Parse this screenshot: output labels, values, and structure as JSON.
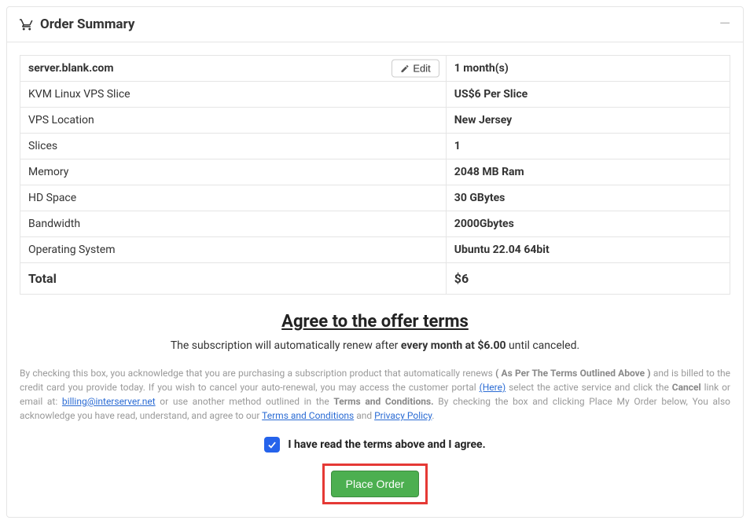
{
  "header": {
    "title": "Order Summary"
  },
  "order": {
    "hostname": "server.blank.com",
    "edit_label": "Edit",
    "rows": [
      {
        "label": "KVM Linux VPS Slice",
        "value": "US$6 Per Slice"
      },
      {
        "label": "VPS Location",
        "value": "New Jersey"
      },
      {
        "label": "Slices",
        "value": "1"
      },
      {
        "label": "Memory",
        "value": "2048 MB Ram"
      },
      {
        "label": "HD Space",
        "value": "30 GBytes"
      },
      {
        "label": "Bandwidth",
        "value": "2000Gbytes"
      },
      {
        "label": "Operating System",
        "value": "Ubuntu 22.04 64bit"
      }
    ],
    "duration": "1 month(s)",
    "total_label": "Total",
    "total_value": "$6"
  },
  "terms": {
    "heading": "Agree to the offer terms",
    "sub_prefix": "The subscription will automatically renew after ",
    "sub_bold": "every month at $6.00",
    "sub_suffix": " until canceled.",
    "fine1": "By checking this box, you acknowledge that you are purchasing a subscription product that automatically renews ",
    "fine1_bold": "( As Per The Terms Outlined Above )",
    "fine1_suffix": " and is billed to the credit card you provide today. If you wish to cancel your auto-renewal, you may access the customer portal ",
    "link_here": "(Here)",
    "fine2": " select the active service and click the ",
    "cancel_bold": "Cancel",
    "fine3": " link or email at: ",
    "email": "billing@interserver.net",
    "fine4": " or use another method outlined in the ",
    "tac_bold": "Terms and Conditions.",
    "fine5": " By checking the box and clicking Place My Order below, You also acknowledge you have read, understand, and agree to our ",
    "link_tac": "Terms and Conditions",
    "and": " and ",
    "link_privacy": "Privacy Policy",
    "period": ".",
    "agree_label": "I have read the terms above and I agree.",
    "place_order": "Place Order"
  }
}
